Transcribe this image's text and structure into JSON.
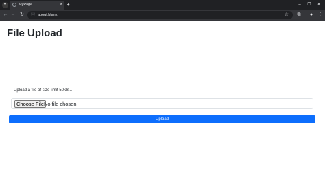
{
  "browser": {
    "tab_title": "MyPage",
    "tab_close": "×",
    "new_tab": "+",
    "url": "about:blank",
    "window_controls": [
      "–",
      "❐",
      "✕"
    ]
  },
  "page": {
    "heading": "File Upload",
    "upload_label": "Upload a file of size limit 50kB...",
    "choose_file_label": "Choose File",
    "no_file_text": "No file chosen",
    "upload_button": "Upload"
  },
  "colors": {
    "primary": "#0d6efd",
    "chrome_dark": "#202124",
    "toolbar": "#35363a"
  }
}
